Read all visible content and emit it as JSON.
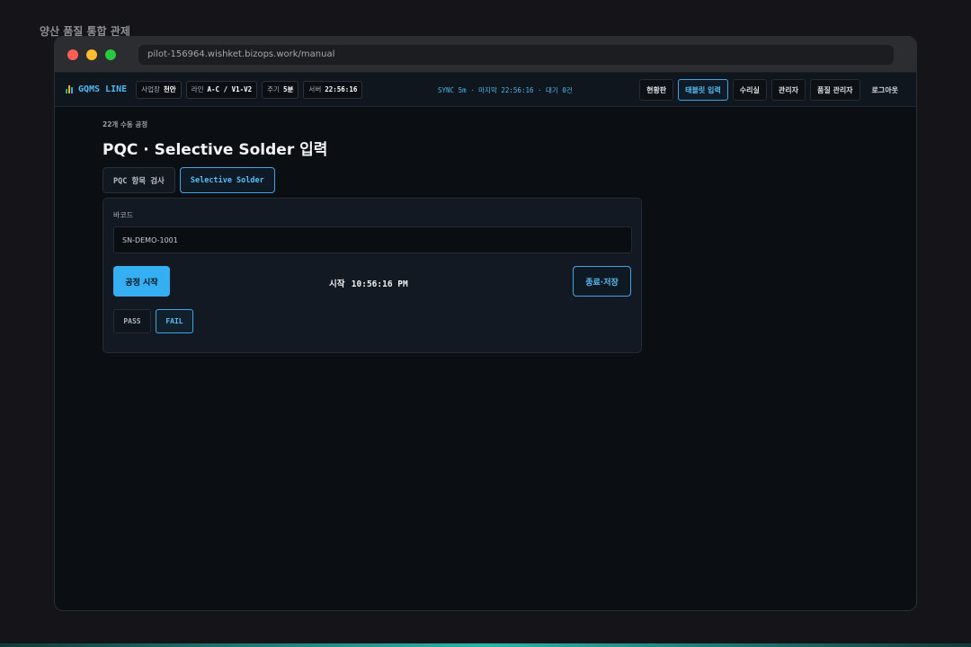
{
  "page_label": "양산 품질 통합 관제",
  "browser": {
    "url": "pilot-156964.wishket.bizops.work/manual"
  },
  "header": {
    "logo_text": "GQMS LINE",
    "logo_bar_colors": [
      "#2fb36b",
      "#e6b422",
      "#3ea6e6"
    ],
    "chips": [
      {
        "label": "사업장",
        "value": "천안"
      },
      {
        "label": "라인",
        "value": "A-C / V1-V2"
      },
      {
        "label": "주기",
        "value": "5분"
      },
      {
        "label": "서버",
        "value": "22:56:16"
      }
    ],
    "status": "SYNC 5m · 마지막 22:56:16 · 대기 0건",
    "nav": [
      {
        "label": "현황판",
        "active": false
      },
      {
        "label": "태블릿 입력",
        "active": true
      },
      {
        "label": "수리실",
        "active": false
      },
      {
        "label": "관리자",
        "active": false
      },
      {
        "label": "품질 관리자",
        "active": false
      },
      {
        "label": "로그아웃",
        "active": false
      }
    ]
  },
  "main": {
    "eyebrow": "22개 수동 공정",
    "title": "PQC · Selective Solder 입력",
    "tabs": [
      {
        "label": "PQC 항목 검사",
        "active": false
      },
      {
        "label": "Selective Solder",
        "active": true
      }
    ],
    "panel": {
      "barcode_label": "바코드",
      "barcode_value": "SN-DEMO-1001",
      "start_button": "공정 시작",
      "start_label": "시작",
      "start_time": "10:56:16 PM",
      "end_button": "종료·저장",
      "pass_button": "PASS",
      "fail_button": "FAIL",
      "selected_result": "FAIL"
    }
  },
  "colors": {
    "accent": "#3ea6e6",
    "background": "#0b0e12"
  }
}
